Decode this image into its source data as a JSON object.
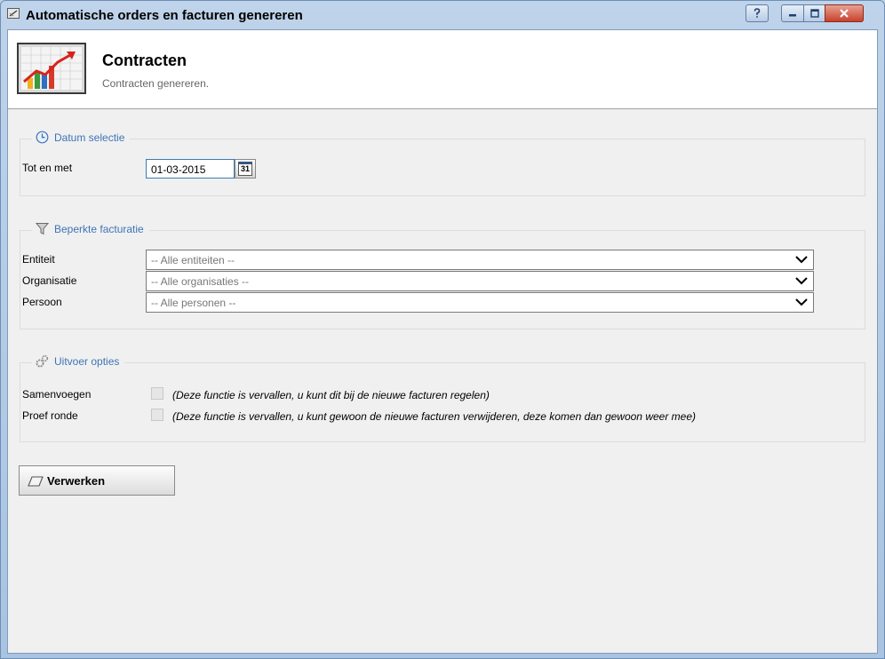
{
  "window": {
    "title": "Automatische orders en facturen genereren",
    "icons": {
      "app": "app-icon",
      "help": "help-icon",
      "minimize": "minimize-icon",
      "maximize": "maximize-icon",
      "close": "close-icon"
    }
  },
  "header": {
    "title": "Contracten",
    "subtitle": "Contracten genereren.",
    "icon": "chart-icon"
  },
  "datum_selectie": {
    "legend": "Datum selectie",
    "icon": "clock-icon",
    "tot_en_met_label": "Tot en met",
    "date_value": "01-03-2015",
    "calendar_day": "31",
    "calendar_icon": "calendar-icon"
  },
  "beperkte_facturatie": {
    "legend": "Beperkte facturatie",
    "icon": "funnel-icon",
    "entiteit_label": "Entiteit",
    "entiteit_value": "-- Alle entiteiten --",
    "organisatie_label": "Organisatie",
    "organisatie_value": "-- Alle organisaties --",
    "persoon_label": "Persoon",
    "persoon_value": "-- Alle personen --"
  },
  "uitvoer_opties": {
    "legend": "Uitvoer opties",
    "icon": "gears-icon",
    "samenvoegen_label": "Samenvoegen",
    "samenvoegen_checked": false,
    "samenvoegen_note": "(Deze functie is vervallen, u kunt dit bij de nieuwe facturen regelen)",
    "proef_ronde_label": "Proef ronde",
    "proef_ronde_checked": false,
    "proef_ronde_note": "(Deze functie is vervallen, u kunt gewoon de nieuwe facturen verwijderen, deze komen dan gewoon weer mee)"
  },
  "actions": {
    "verwerken_label": "Verwerken",
    "verwerken_icon": "eraser-icon"
  },
  "colors": {
    "legend": "#3d74b7",
    "accent_border": "#3d7bad",
    "close_button": "#c7412b"
  }
}
